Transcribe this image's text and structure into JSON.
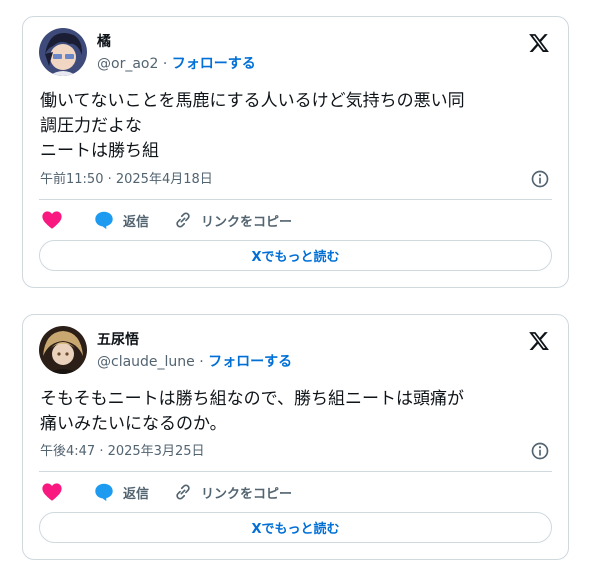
{
  "tweets": [
    {
      "author": {
        "name": "橘",
        "handle": "@or_ao2"
      },
      "separator": "·",
      "follow_label": "フォローする",
      "text": "働いてないことを馬鹿にする人いるけど気持ちの悪い同\n調圧力だよな\nニートは勝ち組",
      "timestamp": "午前11:50 · 2025年4月18日",
      "actions": {
        "reply": "返信",
        "copy_link": "リンクをコピー"
      },
      "read_more": "Xでもっと読む"
    },
    {
      "author": {
        "name": "五尿悟",
        "handle": "@claude_lune"
      },
      "separator": "·",
      "follow_label": "フォローする",
      "text": "そもそもニートは勝ち組なので、勝ち組ニートは頭痛が\n痛いみたいになるのか。",
      "timestamp": "午後4:47 · 2025年3月25日",
      "actions": {
        "reply": "返信",
        "copy_link": "リンクをコピー"
      },
      "read_more": "Xでもっと読む"
    }
  ],
  "colors": {
    "accent": "#006fd6",
    "like": "#f91880",
    "reply": "#1d9bf0",
    "muted": "#536471",
    "border": "#cfd9de"
  },
  "icons": [
    "x-logo-icon",
    "info-icon",
    "heart-icon",
    "reply-bubble-icon",
    "link-icon"
  ]
}
